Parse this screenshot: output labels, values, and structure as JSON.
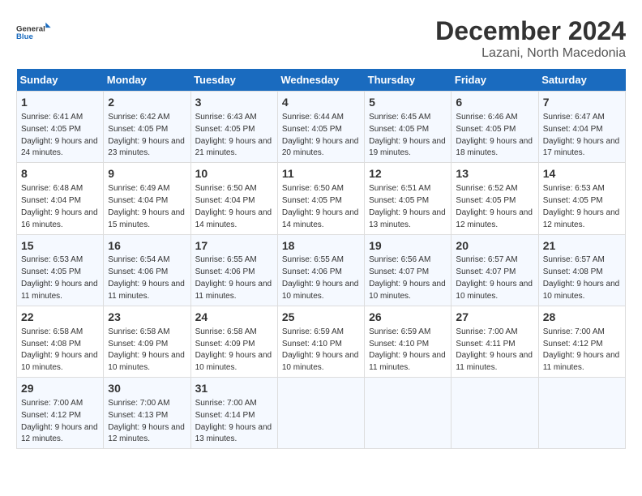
{
  "logo": {
    "line1": "General",
    "line2": "Blue"
  },
  "title": "December 2024",
  "location": "Lazani, North Macedonia",
  "days_of_week": [
    "Sunday",
    "Monday",
    "Tuesday",
    "Wednesday",
    "Thursday",
    "Friday",
    "Saturday"
  ],
  "weeks": [
    [
      {
        "day": 1,
        "sunrise": "6:41 AM",
        "sunset": "4:05 PM",
        "daylight": "9 hours and 24 minutes."
      },
      {
        "day": 2,
        "sunrise": "6:42 AM",
        "sunset": "4:05 PM",
        "daylight": "9 hours and 23 minutes."
      },
      {
        "day": 3,
        "sunrise": "6:43 AM",
        "sunset": "4:05 PM",
        "daylight": "9 hours and 21 minutes."
      },
      {
        "day": 4,
        "sunrise": "6:44 AM",
        "sunset": "4:05 PM",
        "daylight": "9 hours and 20 minutes."
      },
      {
        "day": 5,
        "sunrise": "6:45 AM",
        "sunset": "4:05 PM",
        "daylight": "9 hours and 19 minutes."
      },
      {
        "day": 6,
        "sunrise": "6:46 AM",
        "sunset": "4:05 PM",
        "daylight": "9 hours and 18 minutes."
      },
      {
        "day": 7,
        "sunrise": "6:47 AM",
        "sunset": "4:04 PM",
        "daylight": "9 hours and 17 minutes."
      }
    ],
    [
      {
        "day": 8,
        "sunrise": "6:48 AM",
        "sunset": "4:04 PM",
        "daylight": "9 hours and 16 minutes."
      },
      {
        "day": 9,
        "sunrise": "6:49 AM",
        "sunset": "4:04 PM",
        "daylight": "9 hours and 15 minutes."
      },
      {
        "day": 10,
        "sunrise": "6:50 AM",
        "sunset": "4:04 PM",
        "daylight": "9 hours and 14 minutes."
      },
      {
        "day": 11,
        "sunrise": "6:50 AM",
        "sunset": "4:05 PM",
        "daylight": "9 hours and 14 minutes."
      },
      {
        "day": 12,
        "sunrise": "6:51 AM",
        "sunset": "4:05 PM",
        "daylight": "9 hours and 13 minutes."
      },
      {
        "day": 13,
        "sunrise": "6:52 AM",
        "sunset": "4:05 PM",
        "daylight": "9 hours and 12 minutes."
      },
      {
        "day": 14,
        "sunrise": "6:53 AM",
        "sunset": "4:05 PM",
        "daylight": "9 hours and 12 minutes."
      }
    ],
    [
      {
        "day": 15,
        "sunrise": "6:53 AM",
        "sunset": "4:05 PM",
        "daylight": "9 hours and 11 minutes."
      },
      {
        "day": 16,
        "sunrise": "6:54 AM",
        "sunset": "4:06 PM",
        "daylight": "9 hours and 11 minutes."
      },
      {
        "day": 17,
        "sunrise": "6:55 AM",
        "sunset": "4:06 PM",
        "daylight": "9 hours and 11 minutes."
      },
      {
        "day": 18,
        "sunrise": "6:55 AM",
        "sunset": "4:06 PM",
        "daylight": "9 hours and 10 minutes."
      },
      {
        "day": 19,
        "sunrise": "6:56 AM",
        "sunset": "4:07 PM",
        "daylight": "9 hours and 10 minutes."
      },
      {
        "day": 20,
        "sunrise": "6:57 AM",
        "sunset": "4:07 PM",
        "daylight": "9 hours and 10 minutes."
      },
      {
        "day": 21,
        "sunrise": "6:57 AM",
        "sunset": "4:08 PM",
        "daylight": "9 hours and 10 minutes."
      }
    ],
    [
      {
        "day": 22,
        "sunrise": "6:58 AM",
        "sunset": "4:08 PM",
        "daylight": "9 hours and 10 minutes."
      },
      {
        "day": 23,
        "sunrise": "6:58 AM",
        "sunset": "4:09 PM",
        "daylight": "9 hours and 10 minutes."
      },
      {
        "day": 24,
        "sunrise": "6:58 AM",
        "sunset": "4:09 PM",
        "daylight": "9 hours and 10 minutes."
      },
      {
        "day": 25,
        "sunrise": "6:59 AM",
        "sunset": "4:10 PM",
        "daylight": "9 hours and 10 minutes."
      },
      {
        "day": 26,
        "sunrise": "6:59 AM",
        "sunset": "4:10 PM",
        "daylight": "9 hours and 11 minutes."
      },
      {
        "day": 27,
        "sunrise": "7:00 AM",
        "sunset": "4:11 PM",
        "daylight": "9 hours and 11 minutes."
      },
      {
        "day": 28,
        "sunrise": "7:00 AM",
        "sunset": "4:12 PM",
        "daylight": "9 hours and 11 minutes."
      }
    ],
    [
      {
        "day": 29,
        "sunrise": "7:00 AM",
        "sunset": "4:12 PM",
        "daylight": "9 hours and 12 minutes."
      },
      {
        "day": 30,
        "sunrise": "7:00 AM",
        "sunset": "4:13 PM",
        "daylight": "9 hours and 12 minutes."
      },
      {
        "day": 31,
        "sunrise": "7:00 AM",
        "sunset": "4:14 PM",
        "daylight": "9 hours and 13 minutes."
      },
      null,
      null,
      null,
      null
    ]
  ]
}
